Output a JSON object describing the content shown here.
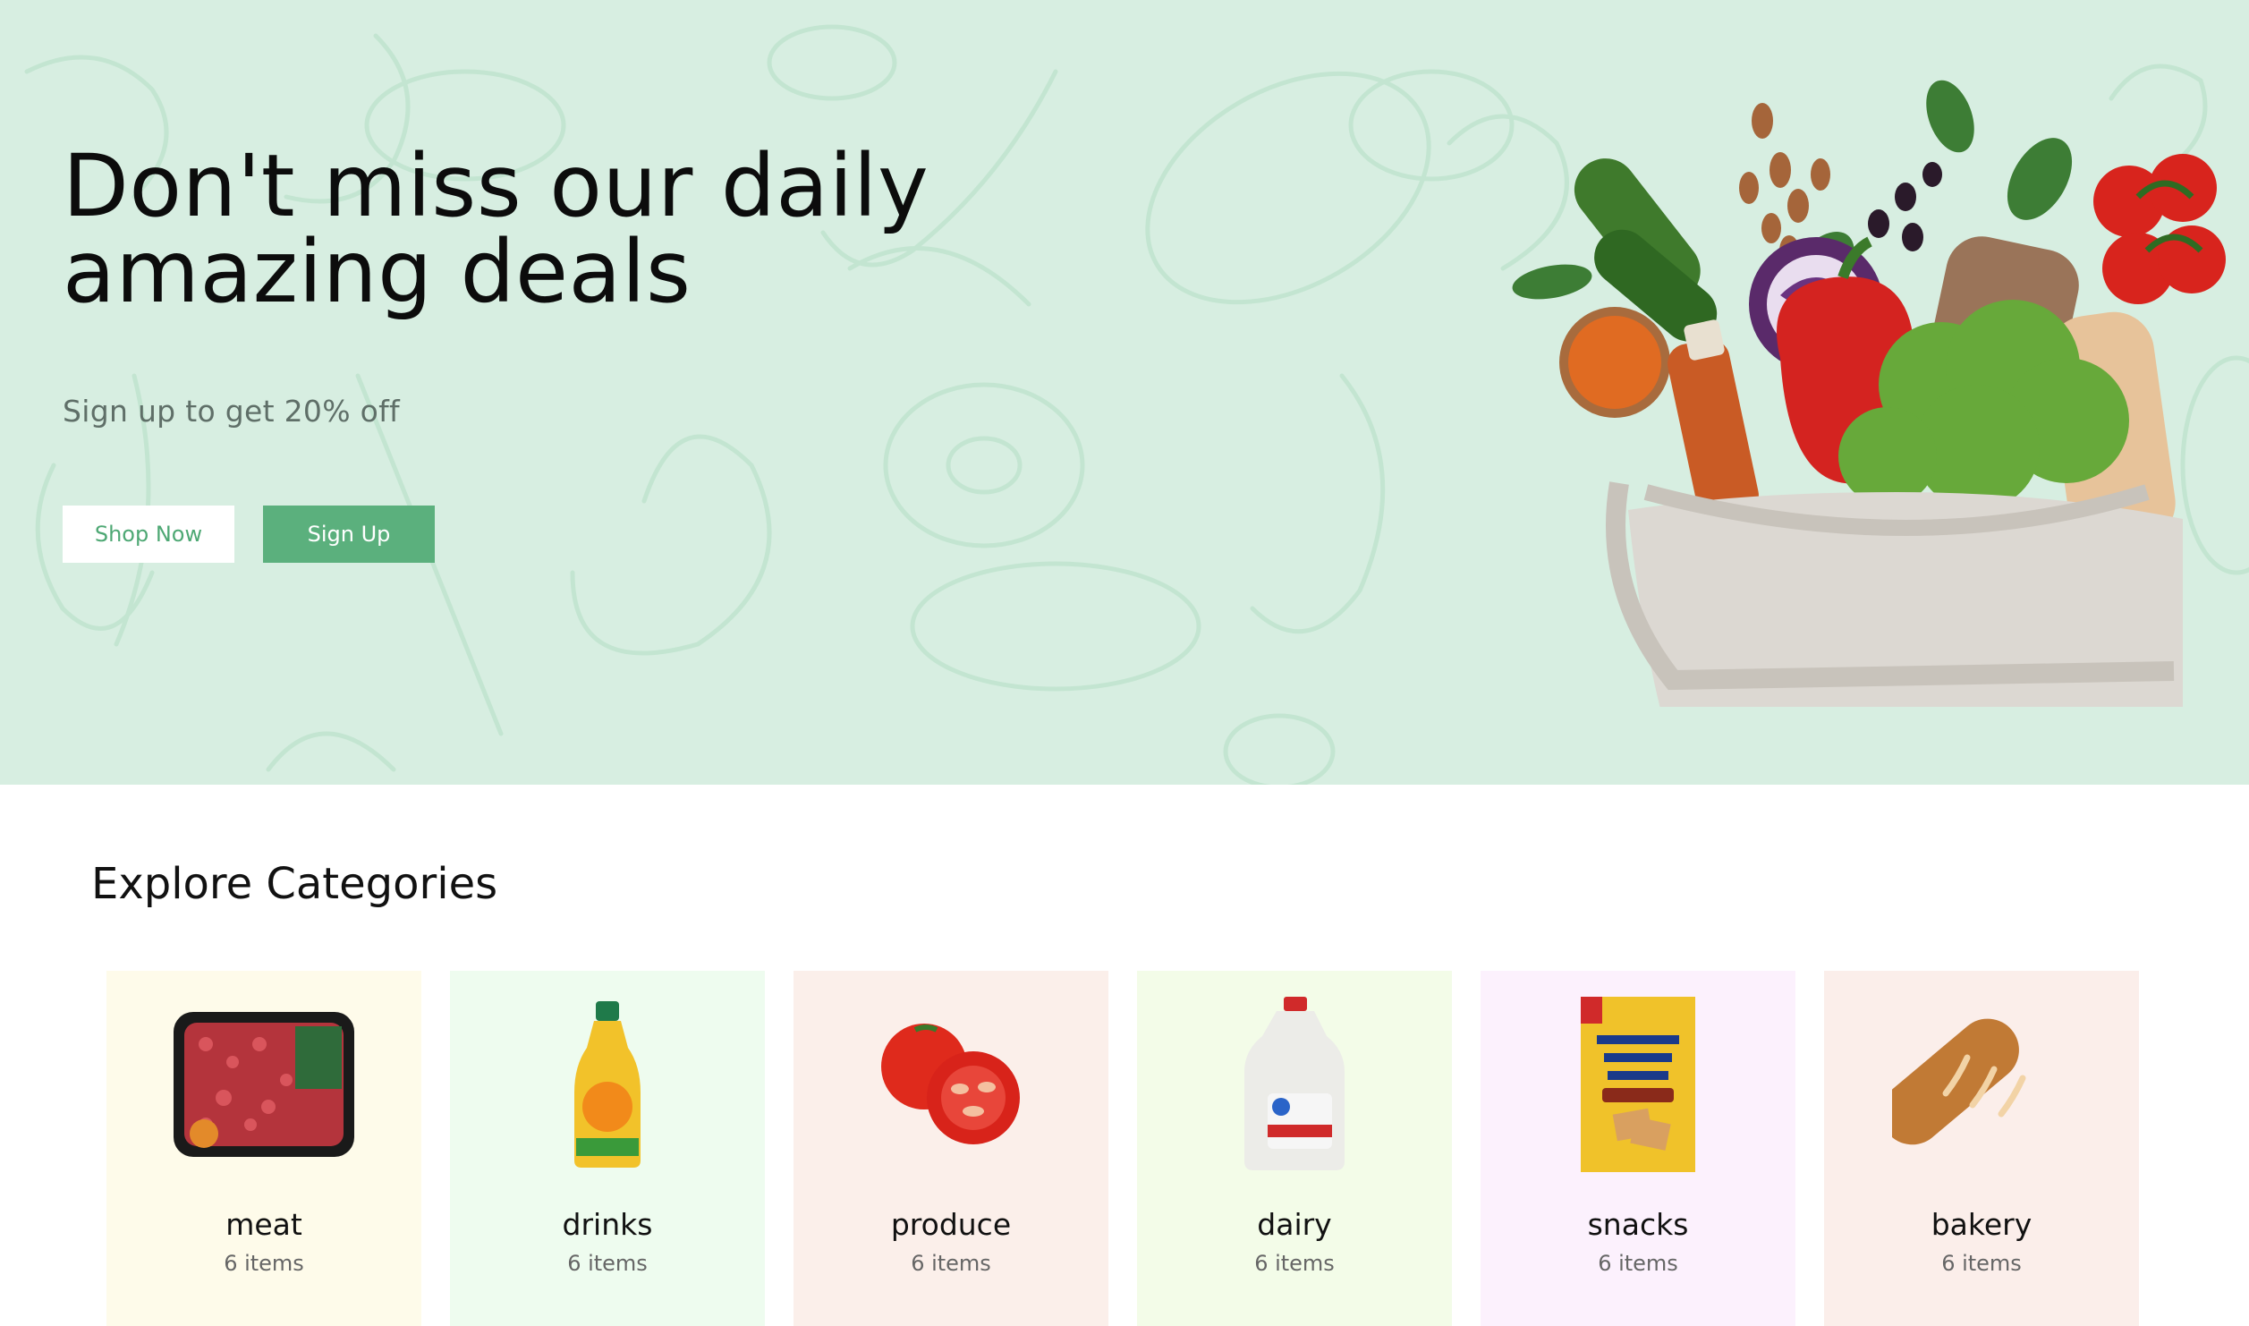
{
  "hero": {
    "title": "Don't miss our daily amazing deals",
    "subtitle": "Sign up to get 20% off",
    "shop_now_label": "Shop Now",
    "sign_up_label": "Sign Up",
    "background_color": "#d7eee1",
    "accent_color": "#5bb07d"
  },
  "categories": {
    "title": "Explore Categories",
    "items": [
      {
        "name": "meat",
        "count": "6 items",
        "bg": "#fefbea",
        "icon": "ground-beef-pack-icon"
      },
      {
        "name": "drinks",
        "count": "6 items",
        "bg": "#eefcef",
        "icon": "orange-juice-bottle-icon"
      },
      {
        "name": "produce",
        "count": "6 items",
        "bg": "#fbefea",
        "icon": "tomato-icon"
      },
      {
        "name": "dairy",
        "count": "6 items",
        "bg": "#f3fce8",
        "icon": "milk-jug-icon"
      },
      {
        "name": "snacks",
        "count": "6 items",
        "bg": "#fcf1fd",
        "icon": "cracker-box-icon"
      },
      {
        "name": "bakery",
        "count": "6 items",
        "bg": "#fbeeea",
        "icon": "bread-loaf-icon"
      }
    ]
  }
}
